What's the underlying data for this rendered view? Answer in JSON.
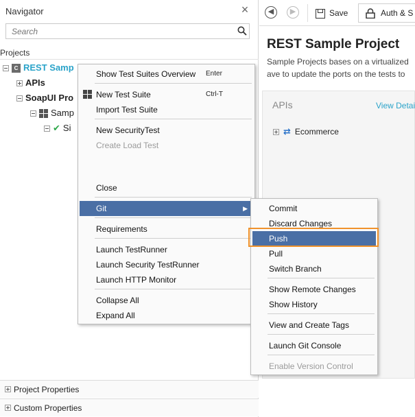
{
  "navigator": {
    "title": "Navigator",
    "close_icon": "×",
    "search_placeholder": "Search",
    "projects_label": "Projects",
    "tree": {
      "project": {
        "badge": "C",
        "label": "REST Samp"
      },
      "apis": "APIs",
      "soapui_project": "SoapUI Pro",
      "sample_suite": "Samp",
      "sim": "Si"
    },
    "bottom": {
      "project_properties": "Project Properties",
      "custom_properties": "Custom Properties"
    }
  },
  "editor": {
    "toolbar": {
      "save": "Save",
      "auth": "Auth & S"
    },
    "title": "REST Sample Project",
    "desc_line1": "Sample Projects bases on a virtualized",
    "desc_line2": "ave to update the ports on the tests to",
    "apis_title": "APIs",
    "view_details": "View Detail",
    "api_item": "Ecommerce"
  },
  "context_menu": {
    "items": [
      {
        "label": "Show Test Suites Overview",
        "shortcut": "Enter"
      },
      {
        "label": "New Test Suite",
        "shortcut": "Ctrl-T",
        "icon": "grid-icon"
      },
      {
        "label": "Import Test Suite"
      },
      {
        "label": "New SecurityTest"
      },
      {
        "label": "Create Load Test",
        "disabled": true
      },
      {
        "label": "Close"
      },
      {
        "label": "Git",
        "submenu": true
      },
      {
        "label": "Requirements"
      },
      {
        "label": "Launch TestRunner"
      },
      {
        "label": "Launch Security TestRunner"
      },
      {
        "label": "Launch HTTP Monitor"
      },
      {
        "label": "Collapse All"
      },
      {
        "label": "Expand All"
      }
    ],
    "submenu_arrow": "▶"
  },
  "git_submenu": {
    "items": [
      {
        "label": "Commit"
      },
      {
        "label": "Discard Changes"
      },
      {
        "label": "Push",
        "selected": true
      },
      {
        "label": "Pull"
      },
      {
        "label": "Switch Branch"
      },
      {
        "label": "Show Remote Changes"
      },
      {
        "label": "Show History"
      },
      {
        "label": "View and Create Tags"
      },
      {
        "label": "Launch Git Console"
      },
      {
        "label": "Enable Version Control",
        "disabled": true
      }
    ]
  },
  "colors": {
    "selection": "#4a6fa5",
    "highlight_border": "#f0922b",
    "link": "#2aa3c9"
  }
}
